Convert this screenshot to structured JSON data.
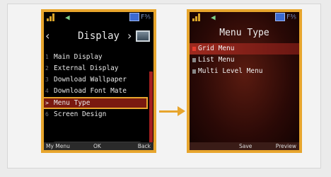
{
  "left_screen": {
    "battery_label": "F⅗",
    "title": "Display",
    "items": [
      {
        "num": "1",
        "label": "Main Display"
      },
      {
        "num": "2",
        "label": "External Display"
      },
      {
        "num": "3",
        "label": "Download Wallpaper"
      },
      {
        "num": "4",
        "label": "Download Font Mate"
      },
      {
        "num": ">",
        "label": "Menu Type"
      },
      {
        "num": "6",
        "label": "Screen Design"
      }
    ],
    "current_value": "Grid Menu",
    "softkeys": {
      "left": "My Menu",
      "center": "OK",
      "right": "Back"
    }
  },
  "right_screen": {
    "battery_label": "F⅗",
    "title": "Menu Type",
    "items": [
      {
        "label": "Grid Menu"
      },
      {
        "label": "List Menu"
      },
      {
        "label": "Multi Level Menu"
      }
    ],
    "softkeys": {
      "center": "Save",
      "right": "Preview"
    }
  },
  "colors": {
    "highlight": "#e7a52d",
    "selection": "#7a1a10",
    "background": "#ebebeb"
  }
}
